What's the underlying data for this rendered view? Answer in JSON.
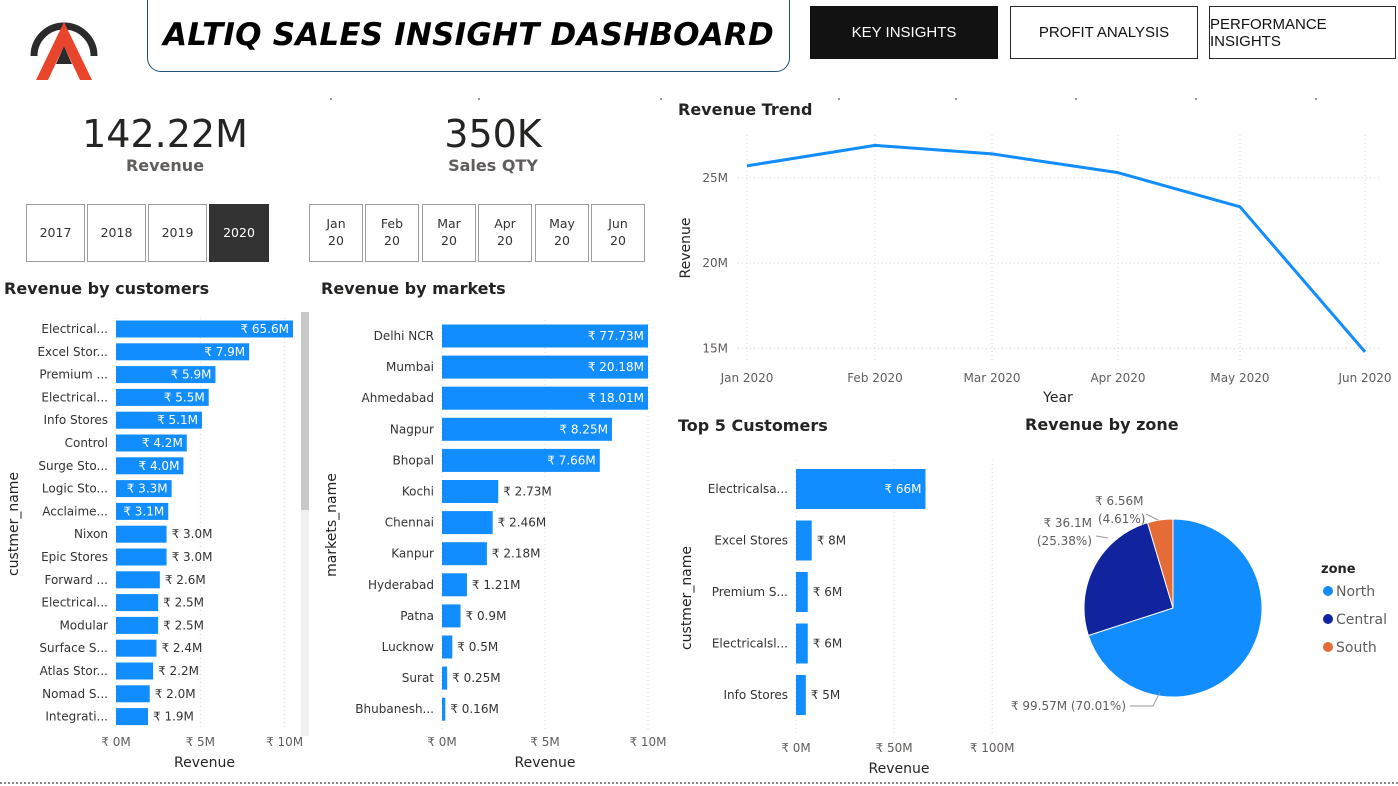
{
  "header": {
    "title": "ALTIQ SALES INSIGHT DASHBOARD",
    "nav": [
      {
        "label": "KEY INSIGHTS",
        "active": true
      },
      {
        "label": "PROFIT ANALYSIS",
        "active": false
      },
      {
        "label": "PERFORMANCE INSIGHTS",
        "active": false
      }
    ]
  },
  "kpis": {
    "revenue": {
      "value": "142.22M",
      "label": "Revenue"
    },
    "sales_qty": {
      "value": "350K",
      "label": "Sales QTY"
    }
  },
  "year_slicer": {
    "options": [
      "2017",
      "2018",
      "2019",
      "2020"
    ],
    "selected": "2020"
  },
  "month_slicer": {
    "options": [
      [
        "Jan",
        "20"
      ],
      [
        "Feb",
        "20"
      ],
      [
        "Mar",
        "20"
      ],
      [
        "Apr",
        "20"
      ],
      [
        "May",
        "20"
      ],
      [
        "Jun",
        "20"
      ]
    ]
  },
  "colors": {
    "bar": "#118DFF",
    "north": "#118DFF",
    "central": "#12239E",
    "south": "#E66C37"
  },
  "chart_data": [
    {
      "id": "customers",
      "type": "bar",
      "orientation": "horizontal",
      "title": "Revenue by customers",
      "xlabel": "Revenue",
      "ylabel": "custmer_name",
      "xlim": [
        0,
        10.5
      ],
      "x_ticks": [
        "₹ 0M",
        "₹ 5M",
        "₹ 10M"
      ],
      "x_tick_values": [
        0,
        5,
        10
      ],
      "categories": [
        "Electrical...",
        "Excel Stor...",
        "Premium ...",
        "Electrical...",
        "Info Stores",
        "Control",
        "Surge Sto...",
        "Logic Sto...",
        "Acclaime...",
        "Nixon",
        "Epic Stores",
        "Forward ...",
        "Electrical...",
        "Modular",
        "Surface S...",
        "Atlas Stor...",
        "Nomad S...",
        "Integrati..."
      ],
      "values": [
        65.6,
        7.9,
        5.9,
        5.5,
        5.1,
        4.2,
        4.0,
        3.3,
        3.1,
        3.0,
        3.0,
        2.6,
        2.5,
        2.5,
        2.4,
        2.2,
        2.0,
        1.9
      ],
      "labels": [
        "₹ 65.6M",
        "₹ 7.9M",
        "₹ 5.9M",
        "₹ 5.5M",
        "₹ 5.1M",
        "₹ 4.2M",
        "₹ 4.0M",
        "₹ 3.3M",
        "₹ 3.1M",
        "₹ 3.0M",
        "₹ 3.0M",
        "₹ 2.6M",
        "₹ 2.5M",
        "₹ 2.5M",
        "₹ 2.4M",
        "₹ 2.2M",
        "₹ 2.0M",
        "₹ 1.9M"
      ]
    },
    {
      "id": "markets",
      "type": "bar",
      "orientation": "horizontal",
      "title": "Revenue by markets",
      "xlabel": "Revenue",
      "ylabel": "markets_name",
      "xlim": [
        0,
        10
      ],
      "x_ticks": [
        "₹ 0M",
        "₹ 5M",
        "₹ 10M"
      ],
      "x_tick_values": [
        0,
        5,
        10
      ],
      "categories": [
        "Delhi NCR",
        "Mumbai",
        "Ahmedabad",
        "Nagpur",
        "Bhopal",
        "Kochi",
        "Chennai",
        "Kanpur",
        "Hyderabad",
        "Patna",
        "Lucknow",
        "Surat",
        "Bhubanesh..."
      ],
      "values": [
        77.73,
        20.18,
        18.01,
        8.25,
        7.66,
        2.73,
        2.46,
        2.18,
        1.21,
        0.9,
        0.5,
        0.25,
        0.16
      ],
      "labels": [
        "₹ 77.73M",
        "₹ 20.18M",
        "₹ 18.01M",
        "₹ 8.25M",
        "₹ 7.66M",
        "₹ 2.73M",
        "₹ 2.46M",
        "₹ 2.18M",
        "₹ 1.21M",
        "₹ 0.9M",
        "₹ 0.5M",
        "₹ 0.25M",
        "₹ 0.16M"
      ]
    },
    {
      "id": "trend",
      "type": "line",
      "title": "Revenue Trend",
      "xlabel": "Year",
      "ylabel": "Revenue",
      "categories": [
        "Jan 2020",
        "Feb 2020",
        "Mar 2020",
        "Apr 2020",
        "May 2020",
        "Jun 2020"
      ],
      "values": [
        25.7,
        26.9,
        26.4,
        25.3,
        23.3,
        14.8
      ],
      "ylim": [
        14.5,
        27.8
      ],
      "y_ticks": [
        "15M",
        "20M",
        "25M"
      ],
      "y_tick_values": [
        15,
        20,
        25
      ]
    },
    {
      "id": "top5",
      "type": "bar",
      "orientation": "horizontal",
      "title": "Top 5 Customers",
      "xlabel": "Revenue",
      "ylabel": "custmer_name",
      "xlim": [
        0,
        105
      ],
      "x_ticks": [
        "₹ 0M",
        "₹ 50M",
        "₹ 100M"
      ],
      "x_tick_values": [
        0,
        50,
        100
      ],
      "categories": [
        "Electricalsa...",
        "Excel Stores",
        "Premium S...",
        "Electricalsl...",
        "Info Stores"
      ],
      "values": [
        66,
        8,
        6,
        6,
        5
      ],
      "labels": [
        "₹ 66M",
        "₹ 8M",
        "₹ 6M",
        "₹ 6M",
        "₹ 5M"
      ]
    },
    {
      "id": "zone",
      "type": "pie",
      "title": "Revenue by zone",
      "legend_title": "zone",
      "legend_position": "right",
      "slices": [
        {
          "name": "North",
          "value": 99.57,
          "percent": 70.01,
          "label_value": "₹ 99.57M",
          "label_pct": "(70.01%)"
        },
        {
          "name": "Central",
          "value": 36.1,
          "percent": 25.38,
          "label_value": "₹ 36.1M",
          "label_pct": "(25.38%)"
        },
        {
          "name": "South",
          "value": 6.56,
          "percent": 4.61,
          "label_value": "₹ 6.56M",
          "label_pct": "(4.61%)"
        }
      ]
    }
  ]
}
